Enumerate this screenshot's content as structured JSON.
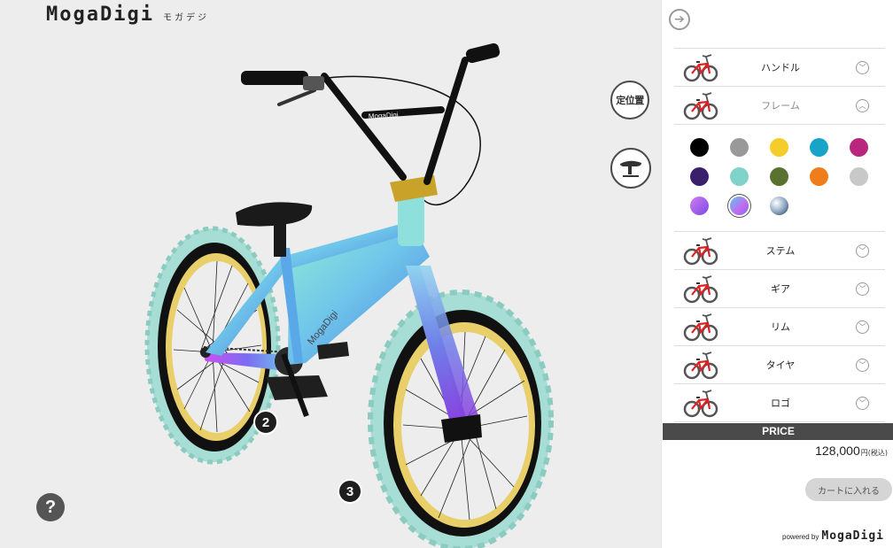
{
  "header": {
    "logo": "MogaDigi",
    "logo_sub": "モガデジ"
  },
  "viewer": {
    "reset_position_label": "定位置",
    "saddle_icon": "saddle-icon",
    "help_label": "?",
    "markers": [
      "2",
      "3"
    ],
    "frame_logo_text": "MogaDigi",
    "down_tube_logo_text": "MogaDigi"
  },
  "panel": {
    "back_icon": "arrow-right-circle-icon",
    "parts": [
      {
        "label": "ハンドル",
        "accent": "#e02020",
        "expanded": false
      },
      {
        "label": "フレーム",
        "accent": "#e02020",
        "expanded": true
      },
      {
        "label": "ステム",
        "accent": "#e02020",
        "expanded": false
      },
      {
        "label": "ギア",
        "accent": "#e02020",
        "expanded": false
      },
      {
        "label": "リム",
        "accent": "#e02020",
        "expanded": false
      },
      {
        "label": "タイヤ",
        "accent": "#e02020",
        "expanded": false
      },
      {
        "label": "ロゴ",
        "accent": "#e02020",
        "expanded": false
      }
    ],
    "frame_colors": [
      {
        "name": "black",
        "color": "#000000"
      },
      {
        "name": "gray",
        "color": "#999999"
      },
      {
        "name": "yellow",
        "color": "#f5cd2a"
      },
      {
        "name": "cyan",
        "color": "#18a3c8"
      },
      {
        "name": "magenta",
        "color": "#b8267e"
      },
      {
        "name": "navy-purple",
        "color": "#3a1f6b"
      },
      {
        "name": "mint",
        "color": "#7fd3c8"
      },
      {
        "name": "olive-green",
        "color": "#5a7230"
      },
      {
        "name": "orange",
        "color": "#f07d1b"
      },
      {
        "name": "light-gray",
        "color": "#c8c8c8"
      },
      {
        "name": "purple-gradient",
        "color": "linear-gradient(135deg,#d17bf5,#7a4ae0)"
      },
      {
        "name": "aurora-gradient",
        "color": "linear-gradient(135deg,#59c7f0,#c46af0 60%,#7b6cf3)",
        "selected": true
      },
      {
        "name": "chrome",
        "color": "radial-gradient(circle at 35% 35%,#ffffff,#8aa2c0 55%,#1e2f48)"
      }
    ],
    "price_label": "PRICE",
    "price_value": "128,000",
    "price_unit": "円(税込)",
    "cart_button": "カートに入れる",
    "powered_by": "powered by",
    "powered_logo": "MogaDigi"
  }
}
